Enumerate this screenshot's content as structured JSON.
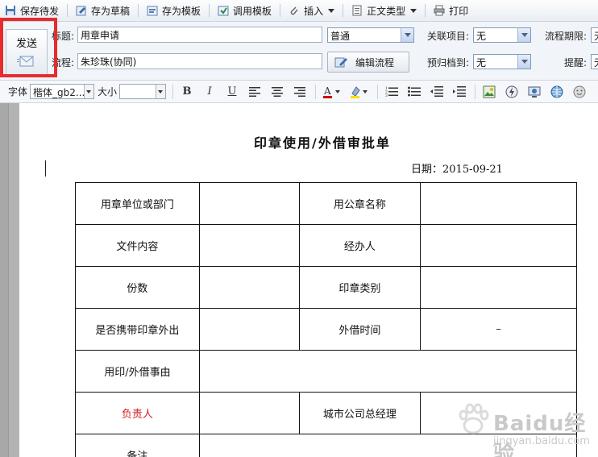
{
  "toolbar": {
    "save_pending": "保存待发",
    "save_draft": "存为草稿",
    "save_template": "存为模板",
    "use_template": "调用模板",
    "insert": "插入",
    "body_type": "正文类型",
    "print": "打印"
  },
  "send": {
    "label": "发送"
  },
  "form": {
    "title_label": "标题:",
    "title_value": "用章申请",
    "priority_value": "普通",
    "related_label": "关联项目:",
    "related_value": "无",
    "deadline_label": "流程期限:",
    "deadline_value": "无",
    "flow_label": "流程:",
    "flow_value": "朱珍珠(协同)",
    "edit_flow": "编辑流程",
    "archive_label": "预归档到:",
    "archive_value": "无",
    "remind_label": "提醒:",
    "remind_value": "无"
  },
  "format": {
    "font_label": "字体",
    "font_value": "楷体_gb2...",
    "size_label": "大小",
    "size_value": ""
  },
  "doc": {
    "title": "印章使用/外借审批单",
    "date": "日期：2015-09-21",
    "rows": [
      [
        "用章单位或部门",
        "",
        "用公章名称",
        ""
      ],
      [
        "文件内容",
        "",
        "经办人",
        ""
      ],
      [
        "份数",
        "",
        "印章类别",
        ""
      ],
      [
        "是否携带印章外出",
        "",
        "外借时间",
        "–"
      ],
      [
        "用印/外借事由",
        ""
      ],
      [
        "负责人",
        "",
        "城市公司总经理",
        ""
      ],
      [
        "备注",
        ""
      ]
    ]
  },
  "watermark": {
    "brand": "Baidu经验",
    "domain": "jingyan.baidu.com"
  }
}
